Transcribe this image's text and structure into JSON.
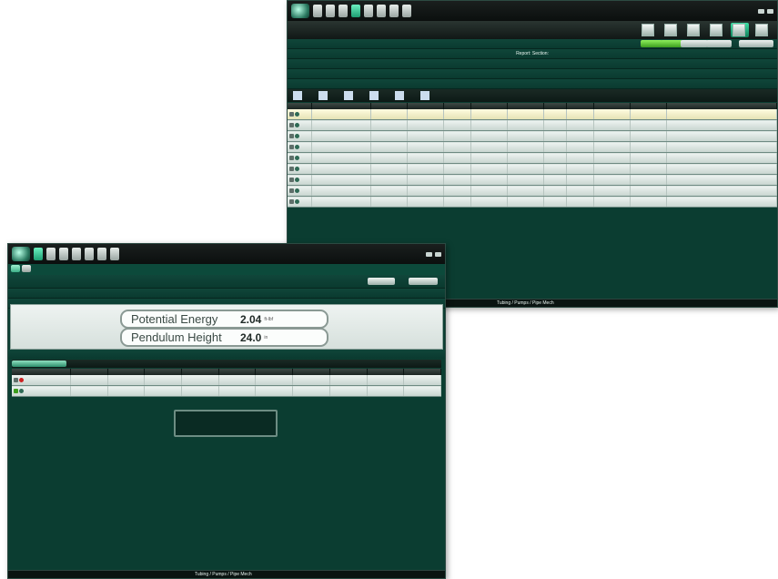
{
  "back_window": {
    "tabs": [
      "",
      "",
      "",
      "",
      "",
      "",
      "",
      ""
    ],
    "toolbar_buttons": [
      "",
      "",
      "",
      "",
      "",
      ""
    ],
    "report_line": {
      "prefix": "Report:",
      "value": "",
      "section_label": "Section:",
      "section_value": ""
    },
    "sections": [
      "",
      "",
      ""
    ],
    "columns": [
      "",
      "",
      "",
      "",
      "",
      "",
      "",
      "",
      "",
      "",
      "",
      ""
    ],
    "rows": [
      [
        "",
        "",
        "",
        "",
        "",
        "",
        "",
        "",
        ""
      ],
      [
        "",
        "",
        "",
        "",
        "",
        "",
        "",
        "",
        ""
      ],
      [
        "",
        "",
        "",
        "",
        "",
        "",
        "",
        "",
        ""
      ],
      [
        "",
        "",
        "",
        "",
        "",
        "",
        "",
        "",
        ""
      ],
      [
        "",
        "",
        "",
        "",
        "",
        "",
        "",
        "",
        ""
      ],
      [
        "",
        "",
        "",
        "",
        "",
        "",
        "",
        "",
        ""
      ],
      [
        "",
        "",
        "",
        "",
        "",
        "",
        "",
        "",
        ""
      ],
      [
        "",
        "",
        "",
        "",
        "",
        "",
        "",
        "",
        ""
      ],
      [
        "",
        "",
        "",
        "",
        "",
        "",
        "",
        "",
        ""
      ]
    ],
    "status_center": "Tubing / Pumps / Pipe Mech"
  },
  "front_window": {
    "tabs": [
      "",
      "",
      "",
      "",
      "",
      "",
      ""
    ],
    "subtabs": [
      "",
      ""
    ],
    "header": {
      "label": "",
      "value": ""
    },
    "buttons": [
      "",
      ""
    ],
    "search_title": "",
    "section_title": "",
    "energy": {
      "potential_label": "Potential Energy",
      "potential_value": "2.04",
      "potential_unit": "ft-lbf",
      "height_label": "Pendulum Height",
      "height_value": "24.0",
      "height_unit": "in"
    },
    "table_toolbar": [
      "",
      "",
      "",
      "",
      "",
      "",
      ""
    ],
    "columns": [
      "",
      "",
      "",
      "",
      "",
      "",
      "",
      "",
      "",
      "",
      ""
    ],
    "rows": [
      {
        "name": "",
        "cells": [
          "",
          "",
          "",
          "",
          "",
          "",
          "",
          "",
          "",
          ""
        ]
      },
      {
        "name": "",
        "cells": [
          "",
          "",
          "",
          "",
          "",
          "",
          "",
          "",
          "",
          ""
        ]
      }
    ],
    "please_wait": "",
    "status_left": "",
    "status_center": "Tubing / Pumps / Pipe Mech",
    "status_right": ""
  }
}
